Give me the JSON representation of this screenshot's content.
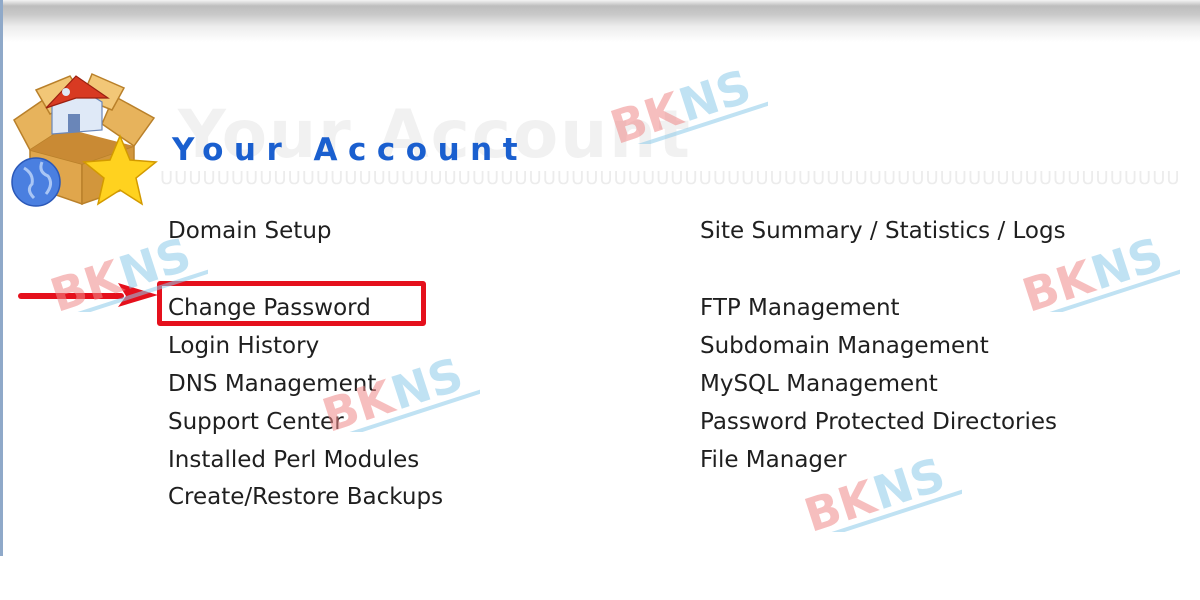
{
  "header": {
    "title": "Your Account",
    "title_shadow": "Your Account",
    "logo_icon": "account-box-house-globe-star-icon"
  },
  "menu": {
    "left": [
      {
        "label": "Domain Setup"
      },
      {
        "label": "Change Password",
        "highlighted": true
      },
      {
        "label": "Login History"
      },
      {
        "label": "DNS Management"
      },
      {
        "label": "Support Center"
      },
      {
        "label": "Installed Perl Modules"
      },
      {
        "label": "Create/Restore Backups"
      }
    ],
    "right": [
      {
        "label": "Site Summary / Statistics / Logs"
      },
      {
        "label": "FTP Management"
      },
      {
        "label": "Subdomain Management"
      },
      {
        "label": "MySQL Management"
      },
      {
        "label": "Password Protected Directories"
      },
      {
        "label": "File Manager"
      }
    ]
  },
  "annotation": {
    "highlight_color": "#e5101c",
    "arrow_target": "Change Password"
  },
  "watermark": {
    "text_part1": "BK",
    "text_part2": "NS",
    "color1": "#f08a8a",
    "color2": "#8ecbea"
  },
  "colors": {
    "title": "#1a5fcf",
    "link_text": "#1f1f1f"
  }
}
